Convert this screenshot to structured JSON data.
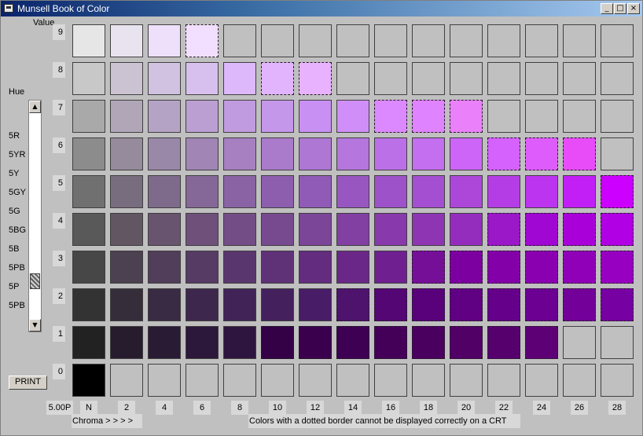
{
  "window": {
    "title": "Munsell Book of Color"
  },
  "titlebar_buttons": {
    "minimize": "_",
    "maximize": "□",
    "close": "×"
  },
  "labels": {
    "value": "Value",
    "hue": "Hue",
    "print": "PRINT",
    "hue_readout": "5.00P",
    "chroma_hint": "Chroma > > > >",
    "note": "Colors with a dotted border cannot be displayed correctly on a CRT"
  },
  "value_labels": [
    "9",
    "8",
    "7",
    "6",
    "5",
    "4",
    "3",
    "2",
    "1",
    "0"
  ],
  "hue_list": [
    "5R",
    "5YR",
    "5Y",
    "5GY",
    "5G",
    "5BG",
    "5B",
    "5PB",
    "5P",
    "5PB"
  ],
  "chroma_labels": [
    "N",
    "2",
    "4",
    "6",
    "8",
    "10",
    "12",
    "14",
    "16",
    "18",
    "20",
    "22",
    "24",
    "26",
    "28"
  ],
  "scrollbar": {
    "up_arrow": "▲",
    "down_arrow": "▼",
    "position_fraction": 0.8
  },
  "grid": {
    "row_values": [
      9,
      8,
      7,
      6,
      5,
      4,
      3,
      2,
      1,
      0
    ],
    "colors": [
      [
        "#e6e6e6",
        "#e9e3ef",
        "#eee0fb",
        "#f2defe",
        "#c0c0c0",
        "#c0c0c0",
        "#c0c0c0",
        "#c0c0c0",
        "#c0c0c0",
        "#c0c0c0",
        "#c0c0c0",
        "#c0c0c0",
        "#c0c0c0",
        "#c0c0c0",
        "#c0c0c0"
      ],
      [
        "#c8c8c8",
        "#cbc2d2",
        "#d0c2e0",
        "#d8c0ee",
        "#ddb8fb",
        "#e2b4fe",
        "#e8b2fe",
        "#c0c0c0",
        "#c0c0c0",
        "#c0c0c0",
        "#c0c0c0",
        "#c0c0c0",
        "#c0c0c0",
        "#c0c0c0",
        "#c0c0c0"
      ],
      [
        "#a9a9a9",
        "#b0a6b8",
        "#b5a3c5",
        "#bb9fd2",
        "#c19bdf",
        "#c597ea",
        "#c990f3",
        "#d08ef8",
        "#dc88fe",
        "#e083fe",
        "#ea80fa",
        "#c0c0c0",
        "#c0c0c0",
        "#c0c0c0",
        "#c0c0c0"
      ],
      [
        "#8c8c8c",
        "#958b9c",
        "#9a88a8",
        "#a185b5",
        "#a680c1",
        "#aa7bcb",
        "#ae77d4",
        "#b576dd",
        "#bc70e8",
        "#c46ef0",
        "#cd66f8",
        "#d562fd",
        "#df5cfc",
        "#e84cf8",
        "#c0c0c0"
      ],
      [
        "#707070",
        "#786d7f",
        "#7e6a8b",
        "#856897",
        "#8963a3",
        "#8c5ead",
        "#905bb6",
        "#9857c0",
        "#9e52c9",
        "#a44fd1",
        "#ac47d9",
        "#b53de5",
        "#bc34ef",
        "#c21ff7",
        "#cc00fe"
      ],
      [
        "#595959",
        "#625663",
        "#68546f",
        "#6e507b",
        "#734d86",
        "#77498f",
        "#7b4598",
        "#8240a2",
        "#8839ab",
        "#8e35b4",
        "#942dbd",
        "#9a18c8",
        "#a107d2",
        "#a900da",
        "#b000e3"
      ],
      [
        "#474747",
        "#4c4150",
        "#513e5a",
        "#563b65",
        "#5a366e",
        "#5f3177",
        "#632c7f",
        "#6a2788",
        "#6f1f90",
        "#750f98",
        "#7c00a0",
        "#8300a9",
        "#8a00b1",
        "#9000b8",
        "#9700c0"
      ],
      [
        "#333333",
        "#362d3b",
        "#3a2b44",
        "#3e274d",
        "#412357",
        "#44205d",
        "#481c66",
        "#4e136d",
        "#530674",
        "#59007b",
        "#600082",
        "#65008a",
        "#6b0093",
        "#720099",
        "#7600a1"
      ],
      [
        "#222222",
        "#271c2d",
        "#2a1b35",
        "#2c183a",
        "#2e153f",
        "#340046",
        "#3a004d",
        "#3d0052",
        "#440059",
        "#4a005f",
        "#510066",
        "#56006e",
        "#5e0075",
        "#c0c0c0",
        "#c0c0c0"
      ],
      [
        "#000000",
        "#c0c0c0",
        "#c0c0c0",
        "#c0c0c0",
        "#c0c0c0",
        "#c0c0c0",
        "#c0c0c0",
        "#c0c0c0",
        "#c0c0c0",
        "#c0c0c0",
        "#c0c0c0",
        "#c0c0c0",
        "#c0c0c0",
        "#c0c0c0",
        "#c0c0c0"
      ]
    ],
    "dotted": [
      [
        false,
        false,
        false,
        true,
        false,
        false,
        false,
        false,
        false,
        false,
        false,
        false,
        false,
        false,
        false
      ],
      [
        false,
        false,
        false,
        false,
        false,
        true,
        true,
        false,
        false,
        false,
        false,
        false,
        false,
        false,
        false
      ],
      [
        false,
        false,
        false,
        false,
        false,
        false,
        false,
        false,
        true,
        true,
        true,
        false,
        false,
        false,
        false
      ],
      [
        false,
        false,
        false,
        false,
        false,
        false,
        false,
        false,
        false,
        false,
        false,
        true,
        true,
        true,
        false
      ],
      [
        false,
        false,
        false,
        false,
        false,
        false,
        false,
        false,
        false,
        false,
        false,
        false,
        false,
        false,
        true
      ],
      [
        false,
        false,
        false,
        false,
        false,
        false,
        false,
        false,
        false,
        false,
        false,
        true,
        true,
        true,
        true
      ],
      [
        false,
        false,
        false,
        false,
        false,
        false,
        false,
        false,
        false,
        true,
        true,
        true,
        true,
        true,
        true
      ],
      [
        false,
        false,
        false,
        false,
        false,
        false,
        false,
        true,
        true,
        true,
        true,
        true,
        true,
        true,
        true
      ],
      [
        false,
        false,
        false,
        false,
        false,
        true,
        true,
        true,
        true,
        true,
        true,
        true,
        true,
        false,
        false
      ],
      [
        false,
        false,
        false,
        false,
        false,
        false,
        false,
        false,
        false,
        false,
        false,
        false,
        false,
        false,
        false
      ]
    ]
  }
}
